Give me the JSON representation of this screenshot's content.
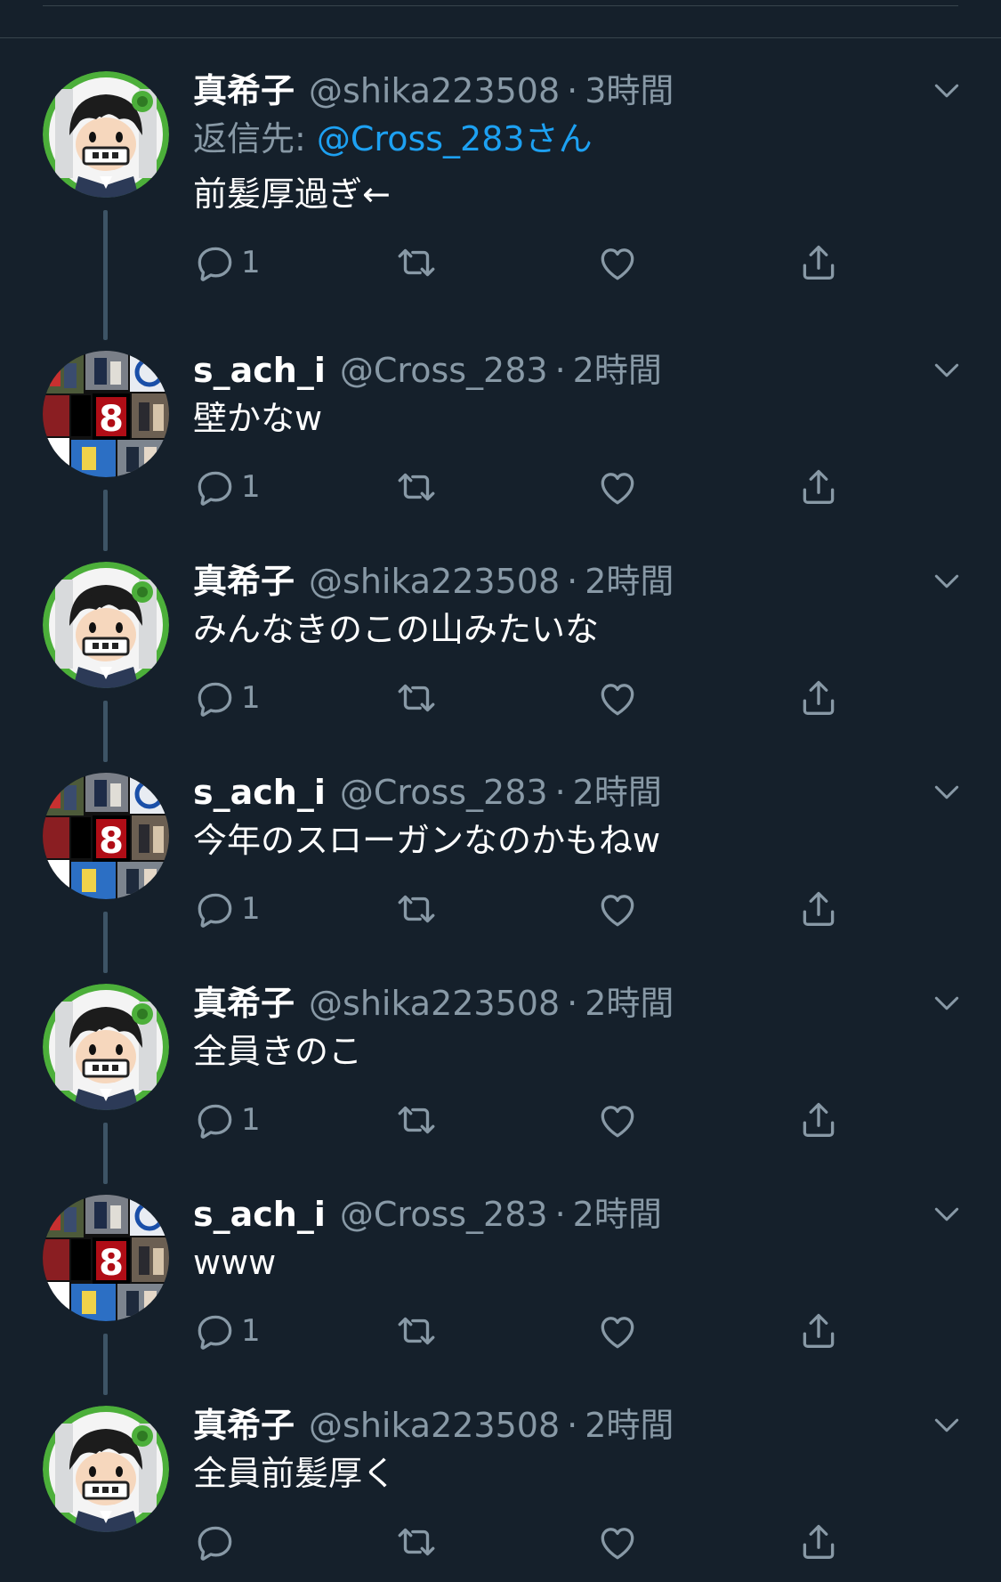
{
  "colors": {
    "background": "#15202b",
    "name_text": "#ffffff",
    "meta_text": "#8899a6",
    "mention": "#1da1f2",
    "divider": "#38444d",
    "thread_line": "#3d5466"
  },
  "icons": {
    "reply": "reply-icon",
    "retweet": "retweet-icon",
    "like": "heart-icon",
    "share": "share-icon",
    "menu": "chevron-down-icon"
  },
  "tweets": [
    {
      "name": "真希子",
      "handle": "@shika223508",
      "separator": "·",
      "time": "3時間",
      "reply_prefix": "返信先: ",
      "reply_to": "@Cross_283さん",
      "text": "前髪厚過ぎ←",
      "reply_count": "1",
      "avatar": "cartoon-avatar"
    },
    {
      "name": "s_ach_i",
      "handle": "@Cross_283",
      "separator": "·",
      "time": "2時間",
      "text": "壁かなw",
      "reply_count": "1",
      "avatar": "collage-avatar"
    },
    {
      "name": "真希子",
      "handle": "@shika223508",
      "separator": "·",
      "time": "2時間",
      "text": "みんなきのこの山みたいな",
      "reply_count": "1",
      "avatar": "cartoon-avatar"
    },
    {
      "name": "s_ach_i",
      "handle": "@Cross_283",
      "separator": "·",
      "time": "2時間",
      "text": "今年のスローガンなのかもねw",
      "reply_count": "1",
      "avatar": "collage-avatar"
    },
    {
      "name": "真希子",
      "handle": "@shika223508",
      "separator": "·",
      "time": "2時間",
      "text": "全員きのこ",
      "reply_count": "1",
      "avatar": "cartoon-avatar"
    },
    {
      "name": "s_ach_i",
      "handle": "@Cross_283",
      "separator": "·",
      "time": "2時間",
      "text": "www",
      "reply_count": "1",
      "avatar": "collage-avatar"
    },
    {
      "name": "真希子",
      "handle": "@shika223508",
      "separator": "·",
      "time": "2時間",
      "text": "全員前髪厚く",
      "reply_count": "",
      "avatar": "cartoon-avatar"
    }
  ]
}
